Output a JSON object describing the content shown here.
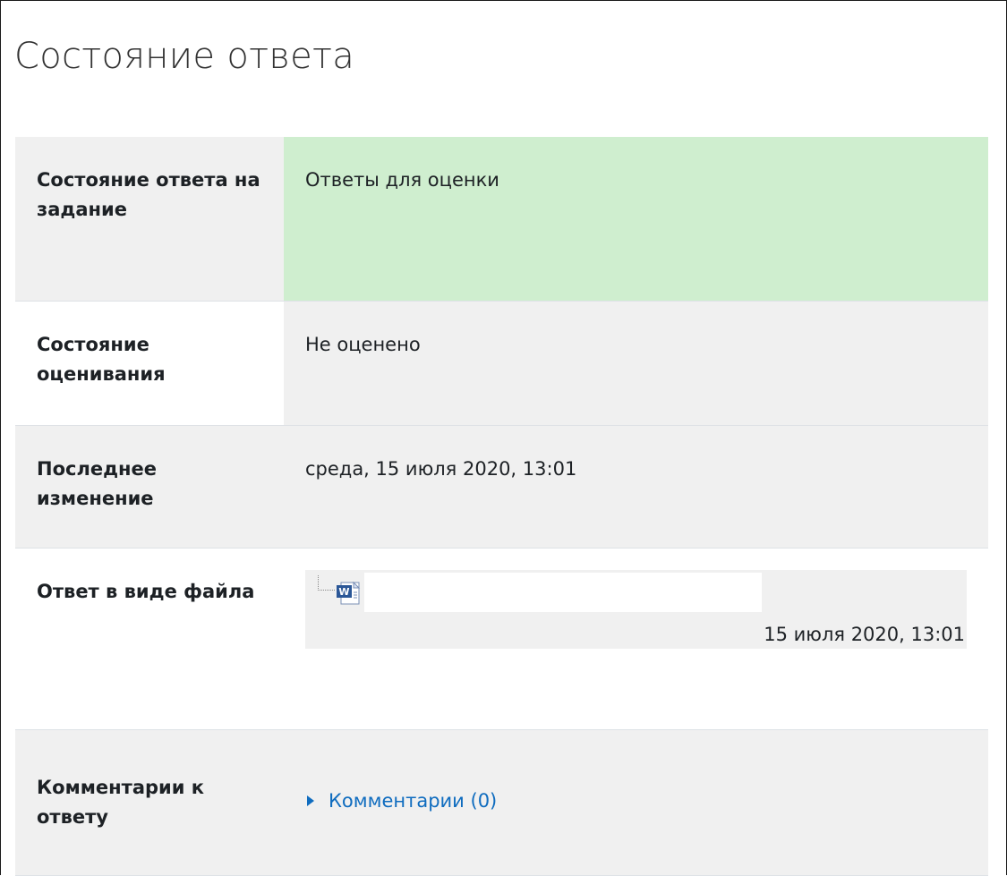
{
  "page": {
    "title": "Состояние ответа"
  },
  "rows": [
    {
      "label": "Состояние ответа на задание",
      "value": "Ответы для оценки"
    },
    {
      "label": "Состояние оценивания",
      "value": "Не оценено"
    },
    {
      "label": "Последнее изменение",
      "value": "среда, 15 июля 2020, 13:01"
    },
    {
      "label": "Ответ в виде файла",
      "file": {
        "icon": "word-document-icon",
        "date": "15 июля 2020, 13:01"
      }
    },
    {
      "label": "Комментарии к ответу",
      "comments_link": "Комментарии (0)"
    }
  ],
  "colors": {
    "submitted_bg": "#cfeecf",
    "row_bg": "#f0f0f0",
    "link": "#0f6cbf"
  }
}
